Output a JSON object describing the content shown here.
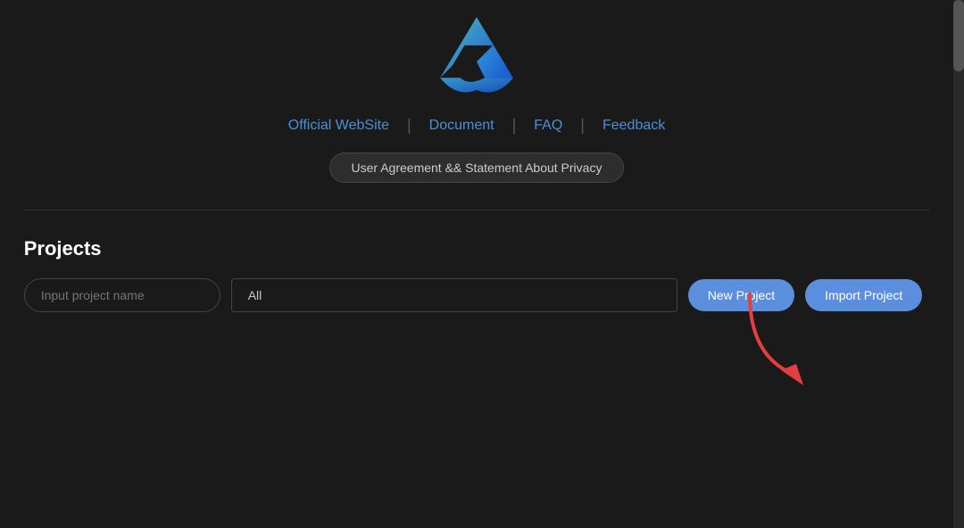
{
  "logo": {
    "alt": "App Logo"
  },
  "nav": {
    "links": [
      {
        "label": "Official WebSite",
        "key": "official-website"
      },
      {
        "label": "Document",
        "key": "document"
      },
      {
        "label": "FAQ",
        "key": "faq"
      },
      {
        "label": "Feedback",
        "key": "feedback"
      }
    ]
  },
  "agreement": {
    "label": "User Agreement && Statement About Privacy"
  },
  "projects": {
    "title": "Projects",
    "search_placeholder": "Input project name",
    "filter_value": "All",
    "new_project_label": "New Project",
    "import_project_label": "Import Project"
  },
  "colors": {
    "accent_blue": "#5b8fde",
    "nav_blue": "#4a90d9",
    "bg": "#1a1a1a",
    "divider": "#333"
  }
}
